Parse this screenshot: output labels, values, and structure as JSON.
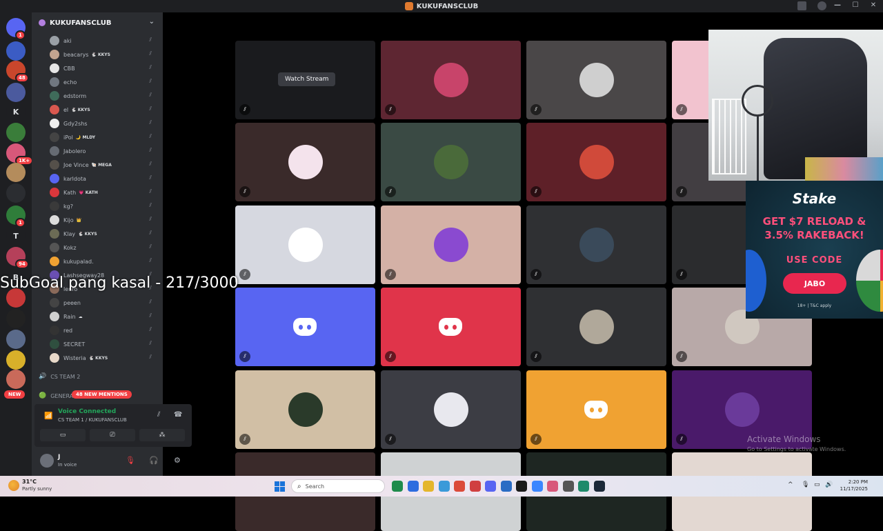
{
  "window": {
    "title": "KUKUFANSCLUB",
    "controls": [
      "—",
      "☐",
      "✕"
    ]
  },
  "rail": {
    "servers": [
      {
        "label": "",
        "color": "#5865f2",
        "badge": "1"
      },
      {
        "label": "",
        "color": "#3b5cc4"
      },
      {
        "label": "",
        "color": "#c9462c",
        "badge": "48"
      },
      {
        "label": "",
        "color": "#4b5a9e"
      },
      {
        "label": "K",
        "color": "#1e1f22"
      },
      {
        "label": "",
        "color": "#3a7d3a"
      },
      {
        "label": "",
        "color": "#d8587a",
        "badge": "1K+"
      },
      {
        "label": "",
        "color": "#b48c5c"
      },
      {
        "label": "",
        "color": "#2b2d31"
      },
      {
        "label": "",
        "color": "#2f7d3a",
        "badge": "1"
      },
      {
        "label": "T",
        "color": "#1e1f22"
      },
      {
        "label": "",
        "color": "#b5405a",
        "badge": "94"
      },
      {
        "label": "B",
        "color": "#1e1f22"
      },
      {
        "label": "",
        "color": "#c73838"
      },
      {
        "label": "",
        "color": "#222222"
      },
      {
        "label": "",
        "color": "#5a6a8a"
      },
      {
        "label": "",
        "color": "#d8b02a"
      },
      {
        "label": "",
        "color": "#c96a5a"
      }
    ],
    "new_label": "NEW"
  },
  "sidebar": {
    "server_name": "KUKUFANSCLUB",
    "members": [
      {
        "name": "aki",
        "tag": "",
        "color": "#9aa0a6"
      },
      {
        "name": "beacarys",
        "tag": "🐇 KKYS",
        "color": "#c2a48f"
      },
      {
        "name": "CBB",
        "tag": "",
        "color": "#e6e6e6"
      },
      {
        "name": "echo",
        "tag": "",
        "color": "#707780"
      },
      {
        "name": "edstorm",
        "tag": "",
        "color": "#3f6b5a"
      },
      {
        "name": "el",
        "tag": "🐇 KKYS",
        "color": "#d9584f"
      },
      {
        "name": "Gdy2shs",
        "tag": "",
        "color": "#eeeeee"
      },
      {
        "name": "iPol",
        "tag": "🌙 MLDY",
        "color": "#444444"
      },
      {
        "name": "Jabolero",
        "tag": "",
        "color": "#666b73"
      },
      {
        "name": "Joe Vince",
        "tag": "🐚 MEGA",
        "color": "#55504a"
      },
      {
        "name": "karldota",
        "tag": "",
        "color": "#5865f2"
      },
      {
        "name": "Kath",
        "tag": "💗 KATH",
        "color": "#da373c"
      },
      {
        "name": "kg?",
        "tag": "",
        "color": "#3a3a3a"
      },
      {
        "name": "Kijo",
        "tag": "👑",
        "color": "#dcdcdc"
      },
      {
        "name": "Klay",
        "tag": "🐇 KKYS",
        "color": "#6b6b55"
      },
      {
        "name": "Kokz",
        "tag": "",
        "color": "#555555"
      },
      {
        "name": "kukupalad.",
        "tag": "",
        "color": "#f0a232"
      },
      {
        "name": "Lashsegway28",
        "tag": "",
        "color": "#6a4fb3"
      },
      {
        "name": "lenro",
        "tag": "",
        "color": "#8a6a5a"
      },
      {
        "name": "peeen",
        "tag": "",
        "color": "#444444"
      },
      {
        "name": "Rain",
        "tag": "☁",
        "color": "#d0d0d0"
      },
      {
        "name": "red",
        "tag": "",
        "color": "#333333"
      },
      {
        "name": "SECRET",
        "tag": "",
        "color": "#2f4f3f"
      },
      {
        "name": "Wisteria",
        "tag": "🐇 KKYS",
        "color": "#e8d9c9"
      }
    ],
    "channels": [
      {
        "name": "CS TEAM 2",
        "icon": "🔊"
      },
      {
        "name": "GENERAL",
        "icon": "🟢"
      }
    ],
    "mentions": "48 NEW MENTIONS",
    "voice": {
      "status": "Voice Connected",
      "location": "CS TEAM 1 / KUKUFANSCLUB"
    },
    "user": {
      "name": "J",
      "status": "In voice"
    }
  },
  "stage": {
    "watch_stream": "Watch Stream",
    "tiles": [
      {
        "bg": "#1a1b1e",
        "avatar": "",
        "stream": true
      },
      {
        "bg": "#5e2632",
        "avatar": "#c8446a"
      },
      {
        "bg": "#4a4748",
        "avatar": "#cfcfcf"
      },
      {
        "bg": "#f2c3cf",
        "avatar": ""
      },
      {
        "bg": "#3a2a2a",
        "avatar": "#f4e3ec"
      },
      {
        "bg": "#3a4a44",
        "avatar": "#4a6a3a"
      },
      {
        "bg": "#5e2028",
        "avatar": "#d04a3a"
      },
      {
        "bg": "#423e42",
        "avatar": ""
      },
      {
        "bg": "#d6d8e0",
        "avatar": "#ffffff"
      },
      {
        "bg": "#d4b1a6",
        "avatar": "#8a4ad0"
      },
      {
        "bg": "#2f3033",
        "avatar": "#3a4a5a"
      },
      {
        "bg": "#2b2c2e",
        "avatar": ""
      },
      {
        "bg": "#5865f2",
        "discord": true
      },
      {
        "bg": "#e0344a",
        "discord": true
      },
      {
        "bg": "#2f3033",
        "avatar": "#b0a89a"
      },
      {
        "bg": "#b8a9a8",
        "avatar": "#d0c8c0"
      },
      {
        "bg": "#d1bfa5",
        "avatar": "#2a3a2a"
      },
      {
        "bg": "#3c3d44",
        "avatar": "#e8e8ee"
      },
      {
        "bg": "#f0a232",
        "discord": true
      },
      {
        "bg": "#4a1a6a",
        "avatar": "#6a3a9a"
      },
      {
        "bg": "#3a2a2a",
        "avatar": ""
      },
      {
        "bg": "#cfd2d3",
        "avatar": ""
      },
      {
        "bg": "#1e2622",
        "avatar": ""
      },
      {
        "bg": "#e3d8d2",
        "avatar": ""
      }
    ]
  },
  "overlay": {
    "subgoal": "SubGoal pang kasal - 217/3000"
  },
  "ad": {
    "brand": "Stake",
    "line1": "GET $7 RELOAD &",
    "line2": "3.5% RAKEBACK!",
    "code_label": "USE CODE",
    "code": "JABO",
    "fine": "18+ | T&C apply"
  },
  "watermark": {
    "line1": "Activate Windows",
    "line2": "Go to Settings to activate Windows."
  },
  "taskbar": {
    "temp": "31°C",
    "condition": "Partly sunny",
    "search": "Search",
    "time": "2:20 PM",
    "date": "11/17/2025",
    "apps": [
      "#1f8b4c",
      "#2d6cdf",
      "#e4b62c",
      "#3a9ad9",
      "#db4a39",
      "#d04040",
      "#5865f2",
      "#2a6cc4",
      "#1a1a1a",
      "#3a86ff",
      "#d8587a",
      "#555555",
      "#1e8a6a",
      "#1b2838"
    ]
  }
}
